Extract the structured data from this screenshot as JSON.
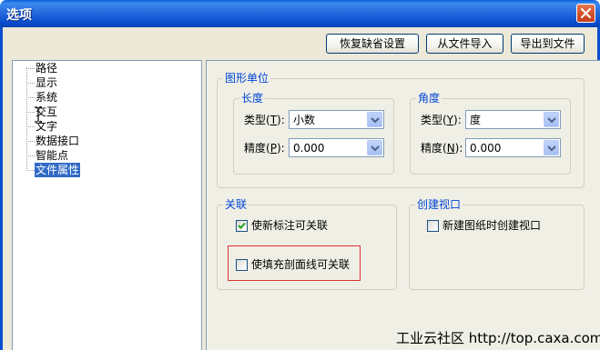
{
  "window": {
    "title": "选项"
  },
  "toolbar": {
    "restore_default": "恢复缺省设置",
    "import_from_file": "从文件导入",
    "export_to_file": "导出到文件"
  },
  "tree": {
    "items": [
      {
        "label": "路径",
        "selected": false
      },
      {
        "label": "显示",
        "selected": false
      },
      {
        "label": "系统",
        "selected": false
      },
      {
        "label": "交互",
        "selected": false
      },
      {
        "label": "文字",
        "selected": false
      },
      {
        "label": "数据接口",
        "selected": false
      },
      {
        "label": "智能点",
        "selected": false
      },
      {
        "label": "文件属性",
        "selected": true
      }
    ]
  },
  "drawing_units": {
    "title": "图形单位",
    "length": {
      "title": "长度",
      "type_label": "类型(T):",
      "type_hotkey_base": "类型(",
      "type_hotkey": "T",
      "type_hotkey_end": "):",
      "type_value": "小数",
      "precision_label_base": "精度(",
      "precision_hotkey": "P",
      "precision_hotkey_end": "):",
      "precision_value": "0.000"
    },
    "angle": {
      "title": "角度",
      "type_label_base": "类型(",
      "type_hotkey": "Y",
      "type_hotkey_end": "):",
      "type_value": "度",
      "precision_label_base": "精度(",
      "precision_hotkey": "N",
      "precision_hotkey_end": "):",
      "precision_value": "0.000"
    }
  },
  "association": {
    "title": "关联",
    "new_dimension_label": "使新标注可关联",
    "new_dimension_checked": true,
    "hatch_label": "使填充剖面线可关联",
    "hatch_checked": false
  },
  "create_viewport": {
    "title": "创建视口",
    "new_drawing_label": "新建图纸时创建视口",
    "new_drawing_checked": false
  },
  "watermark": "工业云社区 http://top.caxa.com/",
  "colors": {
    "accent": "#0046d5",
    "selected": "#316ac5",
    "highlight_border": "#e03030",
    "title_bar": "#0a4fd0"
  }
}
